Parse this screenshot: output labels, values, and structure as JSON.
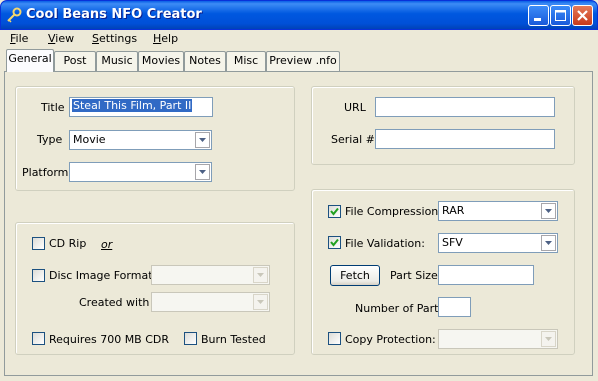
{
  "window": {
    "title": "Cool Beans NFO Creator"
  },
  "menu": [
    {
      "label": "File",
      "u": "F",
      "rest": "ile"
    },
    {
      "label": "View",
      "u": "V",
      "rest": "iew"
    },
    {
      "label": "Settings",
      "u": "S",
      "rest": "ettings"
    },
    {
      "label": "Help",
      "u": "H",
      "rest": "elp"
    }
  ],
  "tabs": [
    "General",
    "Post",
    "Music",
    "Movies",
    "Notes",
    "Misc",
    "Preview .nfo"
  ],
  "general": {
    "title_label": "Title",
    "title_value": "Steal This Film, Part II",
    "type_label": "Type",
    "type_value": "Movie",
    "platform_label": "Platform",
    "platform_value": "",
    "url_label": "URL",
    "url_value": "",
    "serial_label": "Serial #",
    "serial_value": "",
    "cd_rip_label": "CD Rip",
    "or_label": "or",
    "disc_image_label": "Disc Image Format",
    "created_with_label": "Created with",
    "requires_cdr_label": "Requires 700 MB CDR",
    "burn_tested_label": "Burn Tested",
    "file_compression_label": "File Compression:",
    "file_compression_value": "RAR",
    "file_validation_label": "File Validation:",
    "file_validation_value": "SFV",
    "fetch_label": "Fetch",
    "part_size_label": "Part Size",
    "number_of_parts_label": "Number of Parts",
    "copy_protection_label": "Copy Protection:"
  }
}
